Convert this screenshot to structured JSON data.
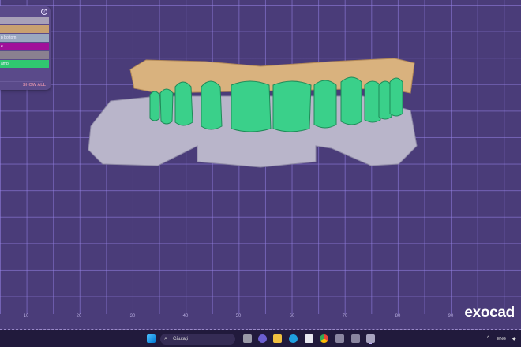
{
  "panel": {
    "items": [
      {
        "label": "",
        "color": "#a8a0b8"
      },
      {
        "label": "",
        "color": "#c8a070"
      },
      {
        "label": "p bottom",
        "color": "#9aa8c0"
      },
      {
        "label": "e",
        "color": "#a0109a"
      },
      {
        "label": "",
        "color": "#8a8090"
      },
      {
        "label": "amp",
        "color": "#30c870"
      }
    ],
    "show_all": "SHOW ALL",
    "help": "?"
  },
  "ruler": {
    "ticks": [
      "10",
      "20",
      "30",
      "40",
      "50",
      "60",
      "70",
      "80",
      "90"
    ]
  },
  "logo": "exocad",
  "taskbar": {
    "search_placeholder": "Căutați",
    "language": "ENG"
  },
  "colors": {
    "background": "#4a3c79",
    "gingiva": "#d9b27e",
    "teeth": "#3ad08a",
    "lower_jaw": "#b8b4c8"
  }
}
